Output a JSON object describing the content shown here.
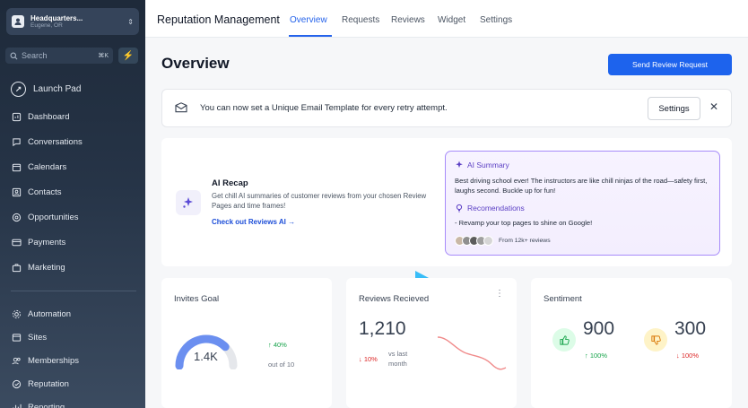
{
  "sidebar": {
    "location_name": "Headquarters...",
    "location_sub": "Eugene, OR",
    "search_placeholder": "Search",
    "search_shortcut": "⌘K",
    "launch_pad": "Launch Pad",
    "items": [
      {
        "label": "Dashboard",
        "icon": "dashboard-icon"
      },
      {
        "label": "Conversations",
        "icon": "chat-icon"
      },
      {
        "label": "Calendars",
        "icon": "calendar-icon"
      },
      {
        "label": "Contacts",
        "icon": "contacts-icon"
      },
      {
        "label": "Opportunities",
        "icon": "target-icon"
      },
      {
        "label": "Payments",
        "icon": "credit-card-icon"
      },
      {
        "label": "Marketing",
        "icon": "briefcase-icon"
      }
    ],
    "items2": [
      {
        "label": "Automation",
        "icon": "automation-icon"
      },
      {
        "label": "Sites",
        "icon": "sites-icon"
      },
      {
        "label": "Memberships",
        "icon": "memberships-icon"
      },
      {
        "label": "Reputation",
        "icon": "reputation-icon"
      },
      {
        "label": "Reporting",
        "icon": "reporting-icon"
      }
    ]
  },
  "topnav": {
    "title": "Reputation Management",
    "tabs": [
      "Overview",
      "Requests",
      "Reviews",
      "Widget",
      "Settings"
    ]
  },
  "main": {
    "title": "Overview",
    "send_button": "Send  Review Request",
    "banner_text": "You can now set a Unique Email Template for every retry attempt.",
    "banner_settings": "Settings",
    "recap": {
      "title": "AI Recap",
      "desc": "Get chill AI summaries of customer reviews from your chosen Review Pages and time frames!",
      "link": "Check out Reviews AI"
    },
    "summary": {
      "title": "AI Summary",
      "text": "Best driving school ever! The instructors are like chill ninjas of the road—safety first, laughs second. Buckle up for fun!",
      "rec_title": "Recomendations",
      "rec_text": "- Revamp your top pages to shine on Google!",
      "from_text": "From 12k+ reviews"
    }
  },
  "cards": {
    "invites": {
      "title": "Invites Goal",
      "value": "1.4K",
      "delta": "40%",
      "of": "out of 10",
      "fill": 0.75
    },
    "reviews": {
      "title": "Reviews Recieved",
      "value": "1,210",
      "delta": "10%",
      "vs": "vs last",
      "month": "month"
    },
    "sentiment": {
      "title": "Sentiment",
      "positive": "900",
      "positive_delta": "100%",
      "negative": "300",
      "negative_delta": "100%"
    }
  },
  "colors": {
    "accent": "#1d63ed",
    "summary_border": "#a78bfa",
    "positive": "#16a34a",
    "negative": "#dc2626"
  }
}
